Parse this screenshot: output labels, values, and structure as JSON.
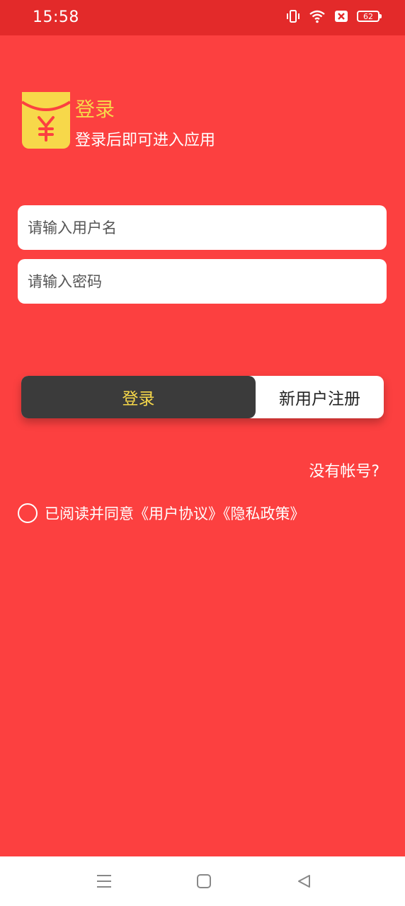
{
  "status_bar": {
    "time": "15:58",
    "battery": "62",
    "icons": [
      "vibrate-icon",
      "wifi-icon",
      "sim-off-icon",
      "battery-icon"
    ]
  },
  "header": {
    "logo_icon": "red-envelope-yuan-icon",
    "title": "登录",
    "subtitle": "登录后即可进入应用"
  },
  "form": {
    "username_placeholder": "请输入用户名",
    "password_placeholder": "请输入密码",
    "username_value": "",
    "password_value": ""
  },
  "buttons": {
    "login": "登录",
    "register": "新用户注册"
  },
  "links": {
    "no_account": "没有帐号?"
  },
  "agreement": {
    "text": "已阅读并同意《用户协议》《隐私政策》",
    "checked": false
  },
  "nav": {
    "icons": [
      "menu-icon",
      "home-square-icon",
      "back-triangle-icon"
    ]
  },
  "colors": {
    "background": "#fc4040",
    "status_bar": "#e32a2a",
    "accent_yellow": "#f7d84a",
    "login_button": "#3b3b3b"
  }
}
